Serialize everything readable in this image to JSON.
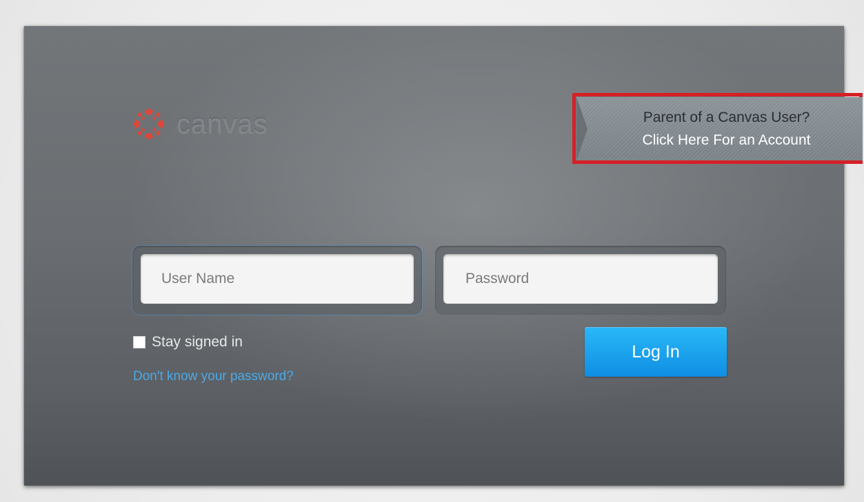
{
  "brand": {
    "name": "canvas",
    "logo_color": "#e0463a"
  },
  "parent_banner": {
    "line1": "Parent of a Canvas User?",
    "line2": "Click Here For an Account",
    "highlight_color": "#d61f26"
  },
  "login_form": {
    "username_placeholder": "User Name",
    "username_value": "",
    "password_placeholder": "Password",
    "password_value": "",
    "stay_signed_in_label": "Stay signed in",
    "stay_signed_in_checked": false,
    "forgot_password_link": "Don't know your password?",
    "login_button_label": "Log In"
  },
  "colors": {
    "accent": "#1aa3ee",
    "link": "#4aa9e8"
  }
}
